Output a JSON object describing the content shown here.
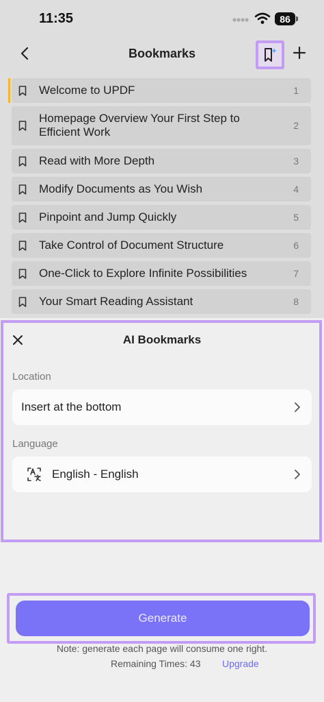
{
  "status_bar": {
    "time": "11:35",
    "battery": "86"
  },
  "nav": {
    "title": "Bookmarks",
    "back_icon": "chevron-left-icon",
    "ai_icon": "bookmark-sparkle-icon",
    "add_icon": "plus-icon"
  },
  "bookmarks": [
    {
      "label": "Welcome to UPDF",
      "page": "1"
    },
    {
      "label": "Homepage Overview Your First Step to Efficient Work",
      "page": "2"
    },
    {
      "label": "Read with More Depth",
      "page": "3"
    },
    {
      "label": "Modify Documents as You Wish",
      "page": "4"
    },
    {
      "label": "Pinpoint and Jump Quickly",
      "page": "5"
    },
    {
      "label": "Take Control of Document Structure",
      "page": "6"
    },
    {
      "label": "One-Click to Explore Infinite Possibilities",
      "page": "7"
    },
    {
      "label": "Your Smart Reading Assistant",
      "page": "8"
    }
  ],
  "sheet": {
    "title": "AI Bookmarks",
    "location_label": "Location",
    "location_value": "Insert at the bottom",
    "language_label": "Language",
    "language_value": "English - English",
    "generate_label": "Generate",
    "note": "Note: generate each page will consume one right.",
    "remaining": "Remaining Times: 43",
    "upgrade": "Upgrade"
  },
  "colors": {
    "accent": "#7a72f7",
    "highlight": "#c39cf3",
    "active_marker": "#f4b62a"
  }
}
